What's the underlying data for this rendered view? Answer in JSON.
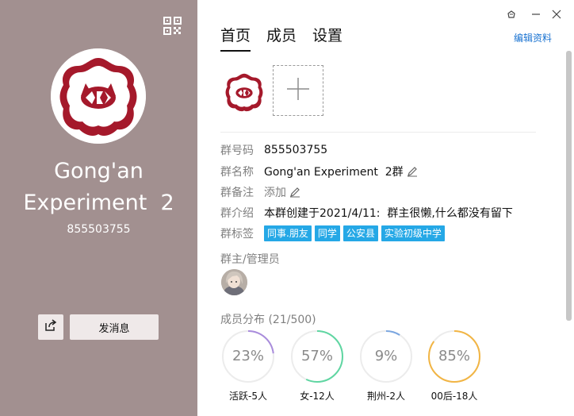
{
  "group": {
    "name_line1": "Gong'an",
    "name_line2": "Experiment  2",
    "id": "855503755"
  },
  "left_panel": {
    "send_label": "发消息"
  },
  "tabs": [
    {
      "label": "首页",
      "active": true
    },
    {
      "label": "成员",
      "active": false
    },
    {
      "label": "设置",
      "active": false
    }
  ],
  "edit_profile_label": "编辑资料",
  "info": {
    "id_label": "群号码",
    "id_value": "855503755",
    "name_label": "群名称",
    "name_value": "Gong'an Experiment  2群",
    "remark_label": "群备注",
    "remark_value": "添加",
    "intro_label": "群介绍",
    "intro_value": "本群创建于2021/4/11:  群主很懒,什么都没有留下",
    "tags_label": "群标签",
    "tags": [
      "同事.朋友",
      "同学",
      "公安县",
      "实验初级中学"
    ]
  },
  "admins_title": "群主/管理员",
  "stats_title": "成员分布 (21/500)",
  "stats": [
    {
      "percent": "23%",
      "label": "活跃-5人",
      "fraction": 0.23,
      "color": "#a98cdc"
    },
    {
      "percent": "57%",
      "label": "女-12人",
      "fraction": 0.57,
      "color": "#5fd6a2"
    },
    {
      "percent": "9%",
      "label": "荆州-2人",
      "fraction": 0.09,
      "color": "#7aa6e0"
    },
    {
      "percent": "85%",
      "label": "00后-18人",
      "fraction": 0.85,
      "color": "#f2b544"
    }
  ],
  "colors": {
    "left_panel_bg": "#a29090",
    "tag_bg": "#25a8e6",
    "link": "#1b73d1",
    "school_logo_red": "#a5192b"
  },
  "icons": {
    "qr": "qr-code-icon",
    "share": "share-icon",
    "skin": "skin-icon",
    "minimize": "minimize-icon",
    "close": "close-icon",
    "add": "plus-icon",
    "edit": "pencil-icon"
  }
}
